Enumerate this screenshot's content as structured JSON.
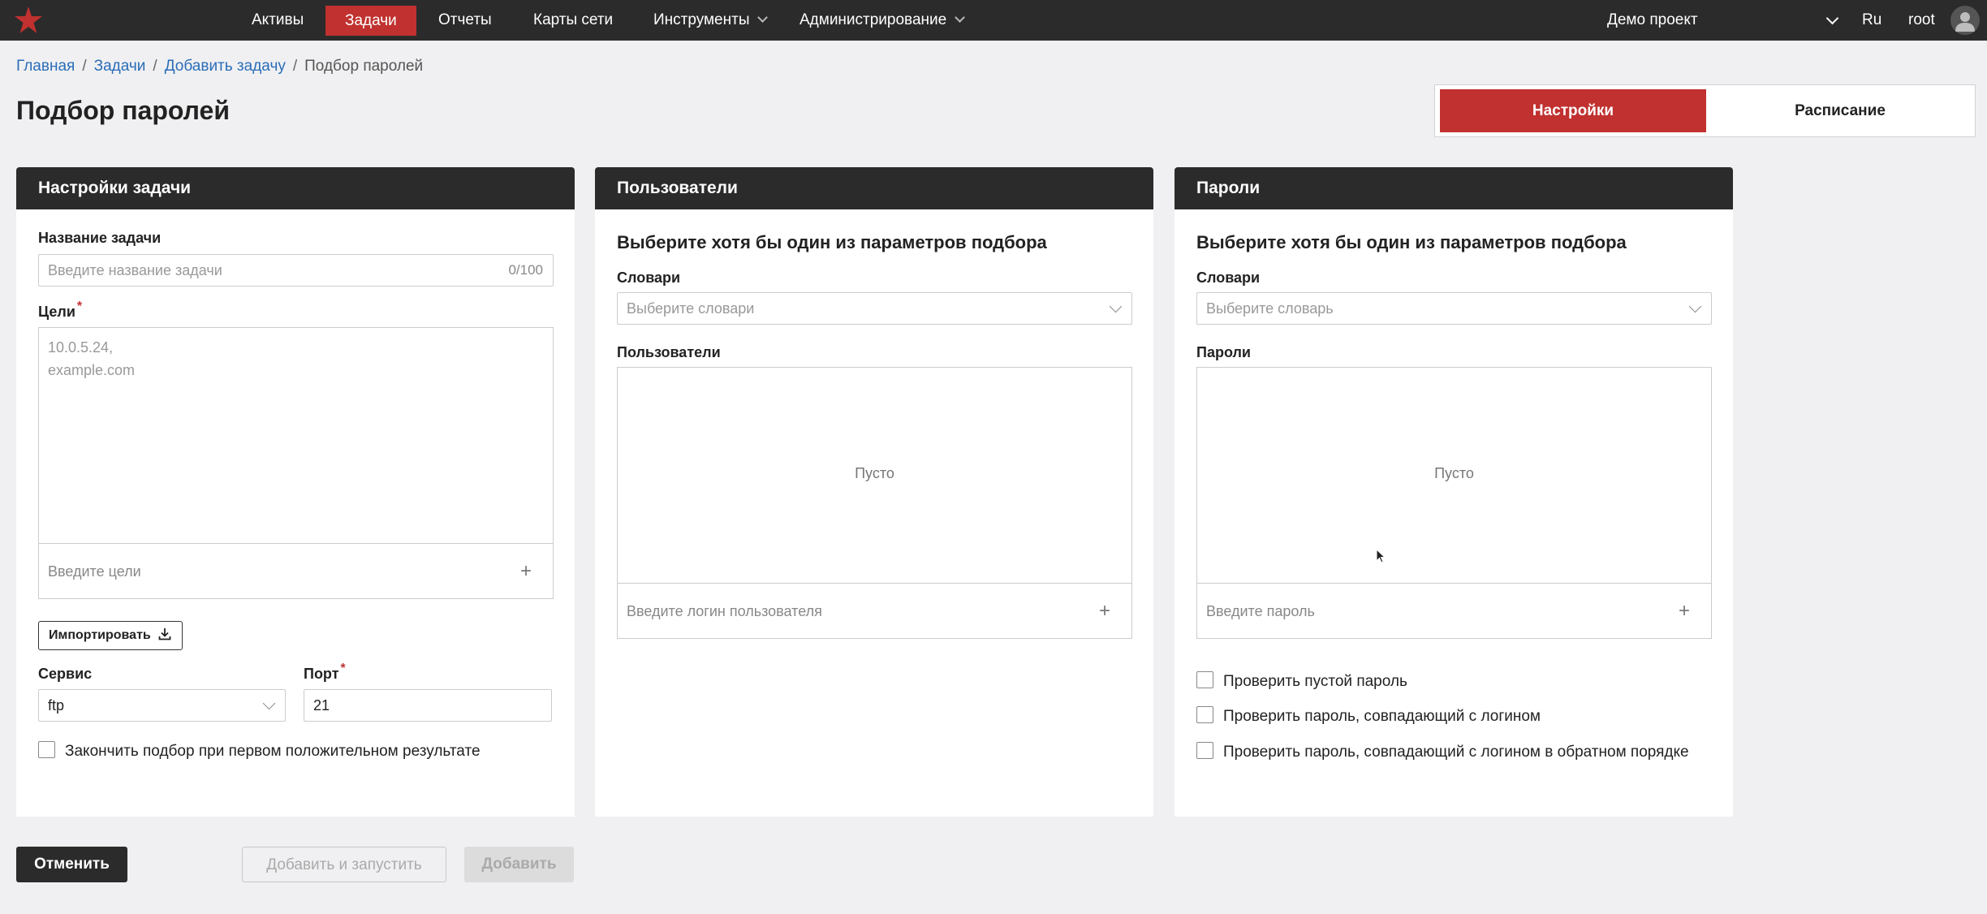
{
  "nav": {
    "items": [
      "Активы",
      "Задачи",
      "Отчеты",
      "Карты сети",
      "Инструменты",
      "Администрирование"
    ],
    "active_index": 1,
    "project": "Демо проект",
    "lang": "Ru",
    "user": "root"
  },
  "breadcrumb": [
    "Главная",
    "Задачи",
    "Добавить задачу",
    "Подбор паролей"
  ],
  "page_title": "Подбор паролей",
  "mode_toggle": {
    "settings": "Настройки",
    "schedule": "Расписание"
  },
  "task_settings": {
    "header": "Настройки задачи",
    "name_label": "Название задачи",
    "name_placeholder": "Введите название задачи",
    "name_counter": "0/100",
    "targets_label": "Цели",
    "targets_placeholder": "10.0.5.24,\nexample.com",
    "targets_input_placeholder": "Введите цели",
    "import_label": "Импортировать",
    "service_label": "Сервис",
    "service_value": "ftp",
    "port_label": "Порт",
    "port_value": "21",
    "stop_on_first_label": "Закончить подбор при первом положительном результате"
  },
  "users_panel": {
    "header": "Пользователи",
    "subtitle": "Выберите хотя бы один из параметров подбора",
    "dict_label": "Словари",
    "dict_placeholder": "Выберите словари",
    "list_label": "Пользователи",
    "empty_text": "Пусто",
    "input_placeholder": "Введите логин пользователя"
  },
  "passwords_panel": {
    "header": "Пароли",
    "subtitle": "Выберите хотя бы один из параметров подбора",
    "dict_label": "Словари",
    "dict_placeholder": "Выберите словарь",
    "list_label": "Пароли",
    "empty_text": "Пусто",
    "input_placeholder": "Введите пароль",
    "check_empty": "Проверить пустой пароль",
    "check_same_login": "Проверить пароль, совпадающий с логином",
    "check_reverse_login": "Проверить пароль, совпадающий с логином в обратном порядке"
  },
  "footer": {
    "cancel": "Отменить",
    "add_and_run": "Добавить и запустить",
    "add": "Добавить"
  },
  "colors": {
    "accent": "#c0312f",
    "dark": "#2b2b2b",
    "link": "#2a6db8"
  }
}
